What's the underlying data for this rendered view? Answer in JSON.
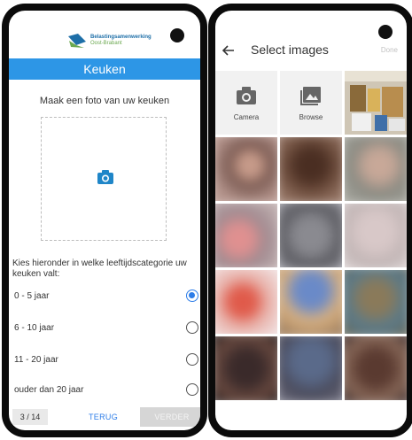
{
  "left_screen": {
    "logo": {
      "line1": "Belastingsamenwerking",
      "line2": "Oost-Brabant"
    },
    "title": "Keuken",
    "photo_prompt": "Maak een foto van uw keuken",
    "photo_icon": "camera-icon",
    "question": "Kies hieronder in welke leeftijdscategorie uw keuken valt:",
    "options": [
      {
        "label": "0 - 5 jaar",
        "selected": true
      },
      {
        "label": "6 - 10 jaar",
        "selected": false
      },
      {
        "label": "11 - 20 jaar",
        "selected": false
      },
      {
        "label": "ouder dan 20 jaar",
        "selected": false
      }
    ],
    "footer": {
      "page": "3 / 14",
      "back": "TERUG",
      "next": "VERDER"
    },
    "colors": {
      "title_bar": "#2d96e6",
      "accent": "#2d7de8",
      "disabled": "#d6d6d6"
    }
  },
  "right_screen": {
    "header": {
      "back_icon": "arrow-left-icon",
      "title": "Select images",
      "done": "Done"
    },
    "actions": [
      {
        "label": "Camera",
        "icon": "camera-icon"
      },
      {
        "label": "Browse",
        "icon": "image-icon"
      }
    ]
  }
}
